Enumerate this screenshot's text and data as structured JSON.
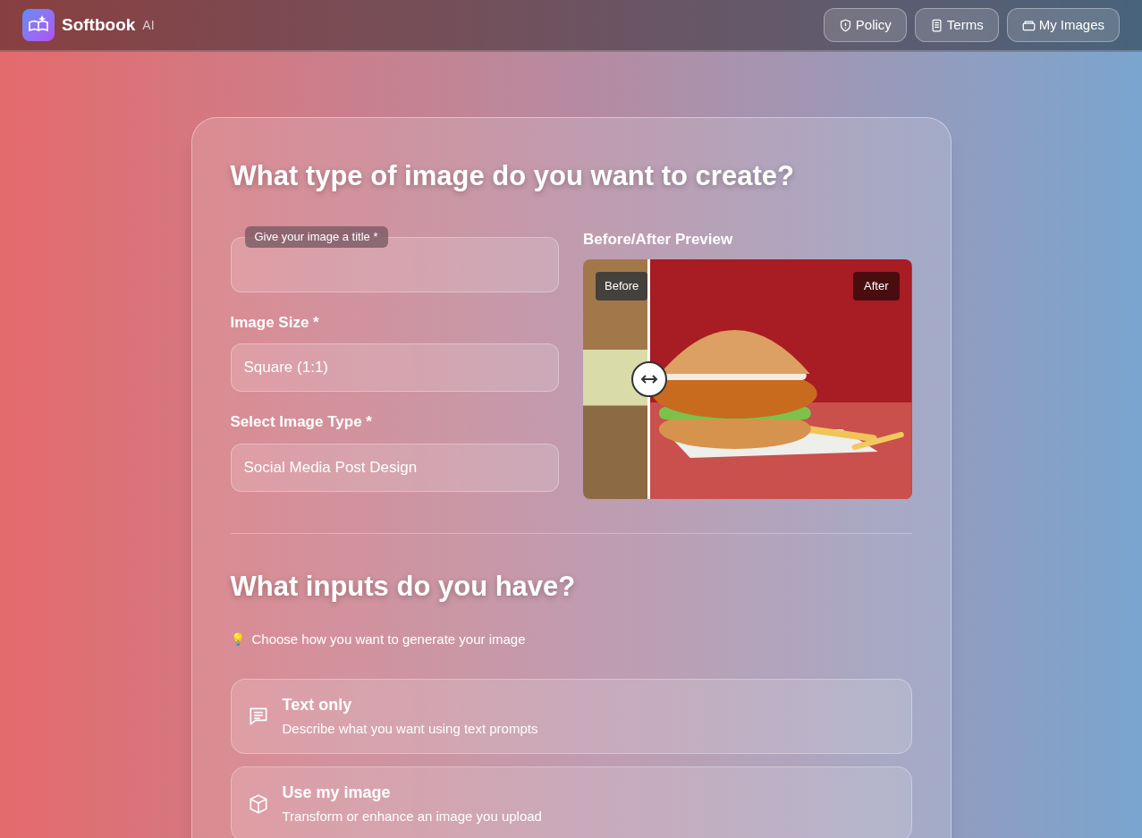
{
  "header": {
    "brand": "Softbook",
    "brand_suffix": "AI",
    "nav": [
      {
        "label": "Policy"
      },
      {
        "label": "Terms"
      },
      {
        "label": "My Images"
      }
    ]
  },
  "section_type": {
    "heading": "What type of image do you want to create?",
    "title_field": {
      "placeholder": "Give your image a title *"
    },
    "size_field": {
      "label": "Image Size *",
      "value": "Square (1:1)"
    },
    "type_field": {
      "label": "Select Image Type *",
      "value": "Social Media Post Design"
    },
    "preview": {
      "label": "Before/After Preview",
      "before_badge": "Before",
      "after_badge": "After",
      "level": 0.2
    }
  },
  "section_inputs": {
    "heading": "What inputs do you have?",
    "hint_icon": "💡",
    "hint": "Choose how you want to generate your image",
    "options": [
      {
        "title": "Text only",
        "description": "Describe what you want using text prompts"
      },
      {
        "title": "Use my image",
        "description": "Transform or enhance an image you upload"
      }
    ]
  }
}
